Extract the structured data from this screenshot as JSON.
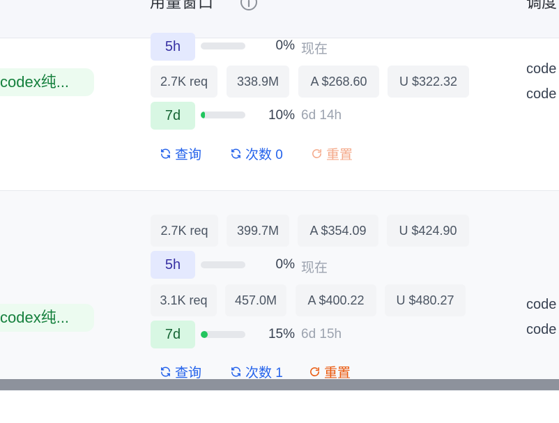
{
  "header": {
    "title": "用量窗口",
    "col2": "调度"
  },
  "rows": [
    {
      "group": "codex纯...",
      "code_lines": [
        "code",
        "code"
      ],
      "stats_top": null,
      "window_5h": {
        "label": "5h",
        "percent": 0,
        "percent_text": "0%",
        "reset": "现在"
      },
      "stats_mid": [
        "2.7K req",
        "338.9M",
        "A $268.60",
        "U $322.32"
      ],
      "window_7d": {
        "label": "7d",
        "percent": 10,
        "percent_text": "10%",
        "reset": "6d 14h"
      },
      "actions": {
        "query": "查询",
        "count": "次数 0",
        "reset": "重置"
      }
    },
    {
      "group": "codex纯...",
      "code_lines": [
        "code",
        "code"
      ],
      "stats_top": [
        "2.7K req",
        "399.7M",
        "A $354.09",
        "U $424.90"
      ],
      "window_5h": {
        "label": "5h",
        "percent": 0,
        "percent_text": "0%",
        "reset": "现在"
      },
      "stats_mid": [
        "3.1K req",
        "457.0M",
        "A $400.22",
        "U $480.27"
      ],
      "window_7d": {
        "label": "7d",
        "percent": 15,
        "percent_text": "15%",
        "reset": "6d 15h"
      },
      "actions": {
        "query": "查询",
        "count": "次数 1",
        "reset": "重置"
      }
    }
  ],
  "colors": {
    "badge_green": "#15803d",
    "bar_green": "#22c55e",
    "action_blue": "#2563eb",
    "action_orange": "#ea580c"
  },
  "icons": [
    "info-icon",
    "refresh-icon",
    "rotate-icon"
  ]
}
